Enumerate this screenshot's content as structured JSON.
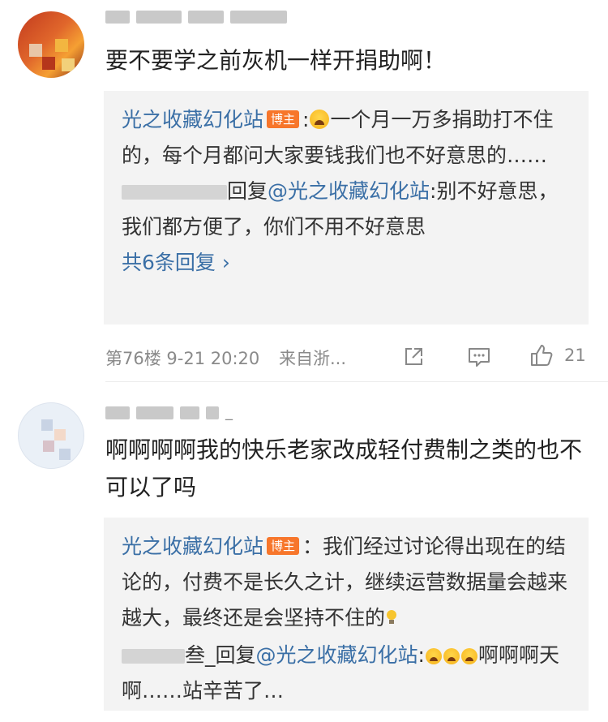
{
  "comments": [
    {
      "username_visible": "",
      "text": "要不要学之前灰机一样开捐助啊！",
      "replies": {
        "author_reply": {
          "author": "光之收藏幻化站",
          "badge": "博主",
          "text": "一个月一万多捐助打不住的，每个月都问大家要钱我们也不好意思的……"
        },
        "user_reply": {
          "prefix": "回复",
          "mention": "@光之收藏幻化站",
          "text": ":别不好意思，我们都方便了，你们不用不好意思"
        },
        "more": "共6条回复 ›"
      },
      "meta": {
        "floor_time": "第76楼 9-21 20:20",
        "location": "来自浙...",
        "likes": "21"
      }
    },
    {
      "username_suffix": "_",
      "text": "啊啊啊啊我的快乐老家改成轻付费制之类的也不可以了吗",
      "replies": {
        "author_reply": {
          "author": "光之收藏幻化站",
          "badge": "博主",
          "text": "：我们经过讨论得出现在的结论的，付费不是长久之计，继续运营数据量会越来越大，最终还是会坚持不住的"
        },
        "user_reply": {
          "name_suffix": "叁_",
          "prefix": "回复",
          "mention": "@光之收藏幻化站",
          "text_after": "啊啊啊天啊……站辛苦了…"
        }
      }
    }
  ],
  "icons": [
    "share-icon",
    "comment-icon",
    "like-icon",
    "crying-emoji-icon",
    "lightbulb-emoji-icon"
  ],
  "colors": {
    "link": "#3a6fa6",
    "badge": "#f7762b",
    "reply_bg": "#f3f3f3"
  }
}
